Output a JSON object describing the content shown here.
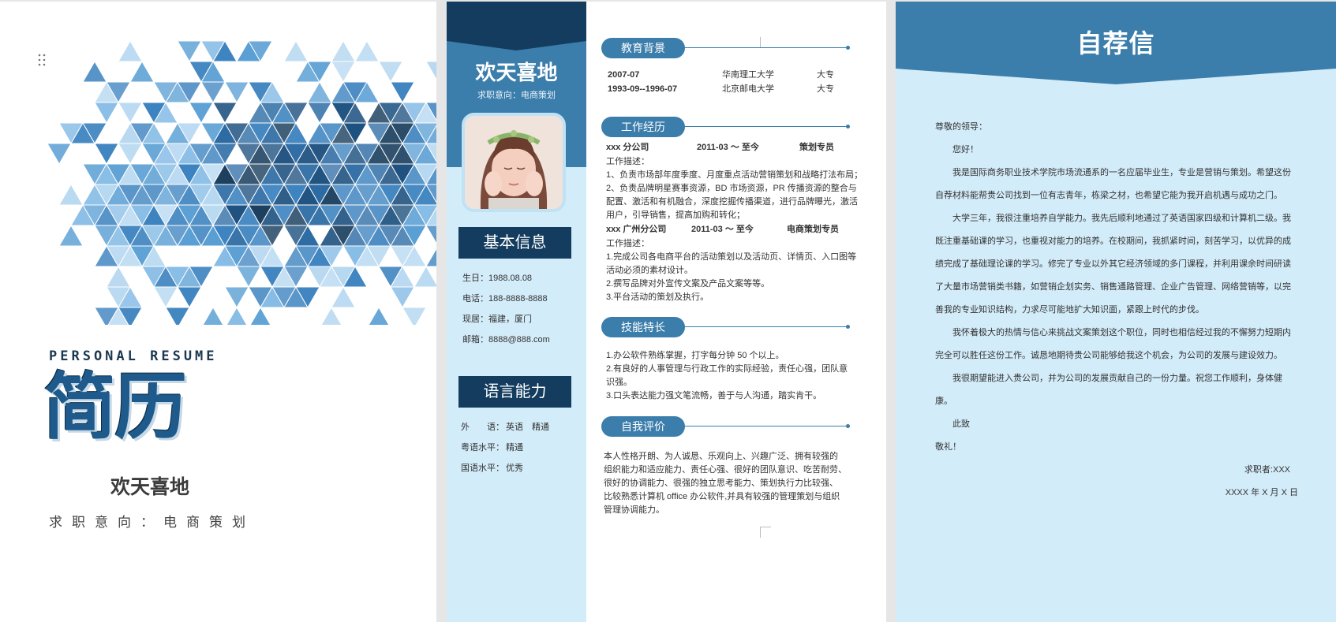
{
  "cover": {
    "title_en": "PERSONAL RESUME",
    "title_cn": "简历",
    "name": "欢天喜地",
    "objective": "求职意向：电商策划"
  },
  "resume": {
    "name": "欢天喜地",
    "objective": "求职意向：电商策划",
    "basic_info": {
      "heading": "基本信息",
      "birthday": "生日：1988.08.08",
      "phone": "电话：188-8888-8888",
      "residence": "现居：福建，厦门",
      "email": "邮箱：8888@888.com"
    },
    "language": {
      "heading": "语言能力",
      "rows": [
        {
          "label": "外　　语：",
          "value": "英语　精通"
        },
        {
          "label": "粤语水平：",
          "value": "精通"
        },
        {
          "label": "国语水平：",
          "value": "优秀"
        }
      ]
    },
    "education": {
      "heading": "教育背景",
      "rows": [
        {
          "period": "2007-07",
          "school": "华南理工大学",
          "degree": "大专"
        },
        {
          "period": "1993-09--1996-07",
          "school": "北京邮电大学",
          "degree": "大专"
        }
      ]
    },
    "work": {
      "heading": "工作经历",
      "jobs": [
        {
          "company": "xxx 分公司",
          "period": "2011-03 ～ 至今",
          "position": "策划专员",
          "desc_label": "工作描述：",
          "lines": [
            "1、负责市场部年度季度、月度重点活动营销策划和战略打法布局；",
            "2、负责品牌明星赛事资源，BD 市场资源，PR 传播资源的整合与",
            "配置、激活和有机融合，深度挖掘传播渠道，进行品牌曝光，激活",
            "用户，引导销售，提高加购和转化；"
          ]
        },
        {
          "company": "xxx 广州分公司",
          "period": "2011-03 ～ 至今",
          "position": "电商策划专员",
          "desc_label": "工作描述：",
          "lines": [
            "1.完成公司各电商平台的活动策划以及活动页、详情页、入口图等",
            "活动必须的素材设计。",
            "2.撰写品牌对外宣传文案及产品文案等等。",
            "3.平台活动的策划及执行。"
          ]
        }
      ]
    },
    "skills": {
      "heading": "技能特长",
      "lines": [
        "1.办公软件熟练掌握，打字每分钟 50 个以上。",
        "2.有良好的人事管理与行政工作的实际经验，责任心强，团队意",
        "识强。",
        "3.口头表达能力强文笔流畅，善于与人沟通，踏实肯干。"
      ]
    },
    "self_eval": {
      "heading": "自我评价",
      "lines": [
        "本人性格开朗、为人诚恳、乐观向上、兴趣广泛、拥有较强的",
        "组织能力和适应能力、责任心强、很好的团队意识、吃苦耐劳、",
        "很好的协调能力、很强的独立思考能力、策划执行力比较强、",
        "比较熟悉计算机 office 办公软件,并具有较强的管理策划与组织",
        "管理协调能力。"
      ]
    }
  },
  "letter": {
    "title": "自荐信",
    "salutation": "尊敬的领导：",
    "greeting": "您好！",
    "paragraphs": [
      "我是国际商务职业技术学院市场流通系的一名应届毕业生，专业是营销与策划。希望这份自荐材料能帮贵公司找到一位有志青年，栋梁之材，也希望它能为我开启机遇与成功之门。",
      "大学三年，我很注重培养自学能力。我先后顺利地通过了英语国家四级和计算机二级。我既注重基础课的学习，也重视对能力的培养。在校期间，我抓紧时间，刻苦学习，以优异的成绩完成了基础理论课的学习。修完了专业以外其它经济领域的多门课程，并利用课余时间研读了大量市场营销类书籍，如营销企划实务、销售通路管理、企业广告管理、网络营销等，以完善我的专业知识结构，力求尽可能地扩大知识面，紧跟上时代的步伐。",
      "我怀着极大的热情与信心来挑战文案策划这个职位，同时也相信经过我的不懈努力短期内完全可以胜任这份工作。诚恳地期待贵公司能够给我这个机会，为公司的发展与建设效力。",
      "我很期望能进入贵公司，并为公司的发展贡献自己的一份力量。祝您工作顺利，身体健康。"
    ],
    "closing": "此致",
    "regards": "敬礼！",
    "signature": "求职者:XXX",
    "date": "XXXX 年 X 月 X 日"
  },
  "colors": {
    "navy": "#133c5e",
    "blue": "#3b7dab",
    "light_blue": "#d3ecf9"
  }
}
